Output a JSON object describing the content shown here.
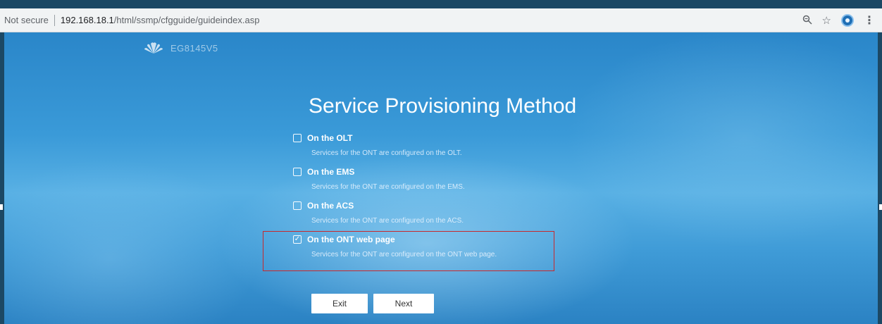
{
  "browser": {
    "security_label": "Not secure",
    "url_host": "192.168.18.1",
    "url_path": "/html/ssmp/cfgguide/guideindex.asp",
    "icons": [
      "zoom-icon",
      "star-icon",
      "extension-icon",
      "menu-icon"
    ]
  },
  "brand": {
    "model": "EG8145V5"
  },
  "page": {
    "title": "Service Provisioning Method",
    "options": [
      {
        "label": "On the OLT",
        "description": "Services for the ONT are configured on the OLT.",
        "checked": false
      },
      {
        "label": "On the EMS",
        "description": "Services for the ONT are configured on the EMS.",
        "checked": false
      },
      {
        "label": "On the ACS",
        "description": "Services for the ONT are configured on the ACS.",
        "checked": false
      },
      {
        "label": "On the ONT web page",
        "description": "Services for the ONT are configured on the ONT web page.",
        "checked": true
      }
    ],
    "buttons": {
      "exit": "Exit",
      "next": "Next"
    }
  },
  "colors": {
    "highlight_border": "#c8282c",
    "background_blue": "#3a9ad8"
  }
}
